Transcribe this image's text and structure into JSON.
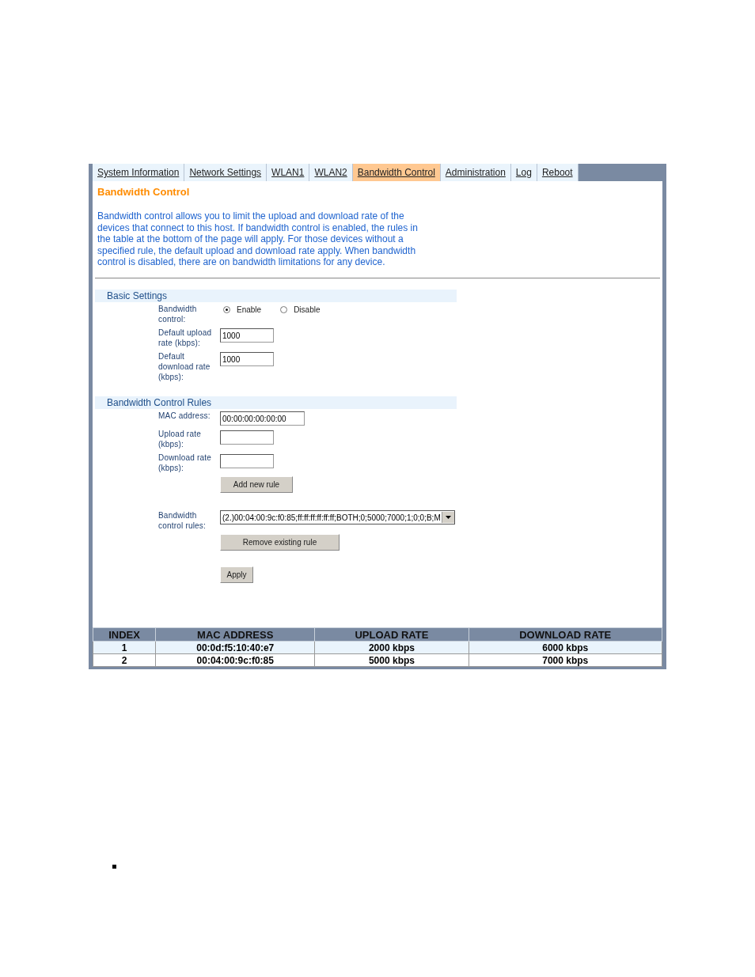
{
  "tabs": [
    {
      "label": "System Information",
      "selected": false
    },
    {
      "label": "Network Settings",
      "selected": false
    },
    {
      "label": "WLAN1",
      "selected": false
    },
    {
      "label": "WLAN2",
      "selected": false
    },
    {
      "label": "Bandwidth Control",
      "selected": true
    },
    {
      "label": "Administration",
      "selected": false
    },
    {
      "label": "Log",
      "selected": false
    },
    {
      "label": "Reboot",
      "selected": false
    }
  ],
  "heading": "Bandwidth Control",
  "description": "Bandwidth control allows you to limit the upload and download rate of the devices that connect to this host. If bandwidth control is enabled, the rules in the table at the bottom of the page will apply. For those devices without a specified rule, the default upload and download rate apply. When bandwidth control is disabled, there are on bandwidth limitations for any device.",
  "basic_settings": {
    "title": "Basic Settings",
    "bandwidth_control": {
      "label": "Bandwidth control:",
      "options": [
        {
          "label": "Enable",
          "selected": true
        },
        {
          "label": "Disable",
          "selected": false
        }
      ]
    },
    "fields": [
      {
        "label": "Default upload rate (kbps):",
        "value": "1000"
      },
      {
        "label": "Default download rate (kbps):",
        "value": "1000"
      }
    ]
  },
  "rules": {
    "title": "Bandwidth Control Rules",
    "fields": [
      {
        "label": "MAC address:",
        "value": "00:00:00:00:00:00",
        "wide": true
      },
      {
        "label": "Upload rate (kbps):",
        "wide": false
      },
      {
        "label": "Download rate (kbps):",
        "wide": false
      }
    ],
    "add_button": "Add new rule",
    "rules_select": {
      "label": "Bandwidth control rules:",
      "value": "(2.)00:04:00:9c:f0:85;ff:ff:ff:ff:ff:ff;BOTH;0;5000;7000;1;0;0;B;M"
    },
    "remove_button": "Remove existing rule",
    "apply_button": "Apply"
  },
  "table": {
    "columns": [
      "INDEX",
      "MAC ADDRESS",
      "UPLOAD RATE",
      "DOWNLOAD RATE"
    ],
    "rows": [
      [
        "1",
        "00:0d:f5:10:40:e7",
        "2000 kbps",
        "6000 kbps"
      ],
      [
        "2",
        "00:04:00:9c:f0:85",
        "5000 kbps",
        "7000 kbps"
      ]
    ]
  }
}
